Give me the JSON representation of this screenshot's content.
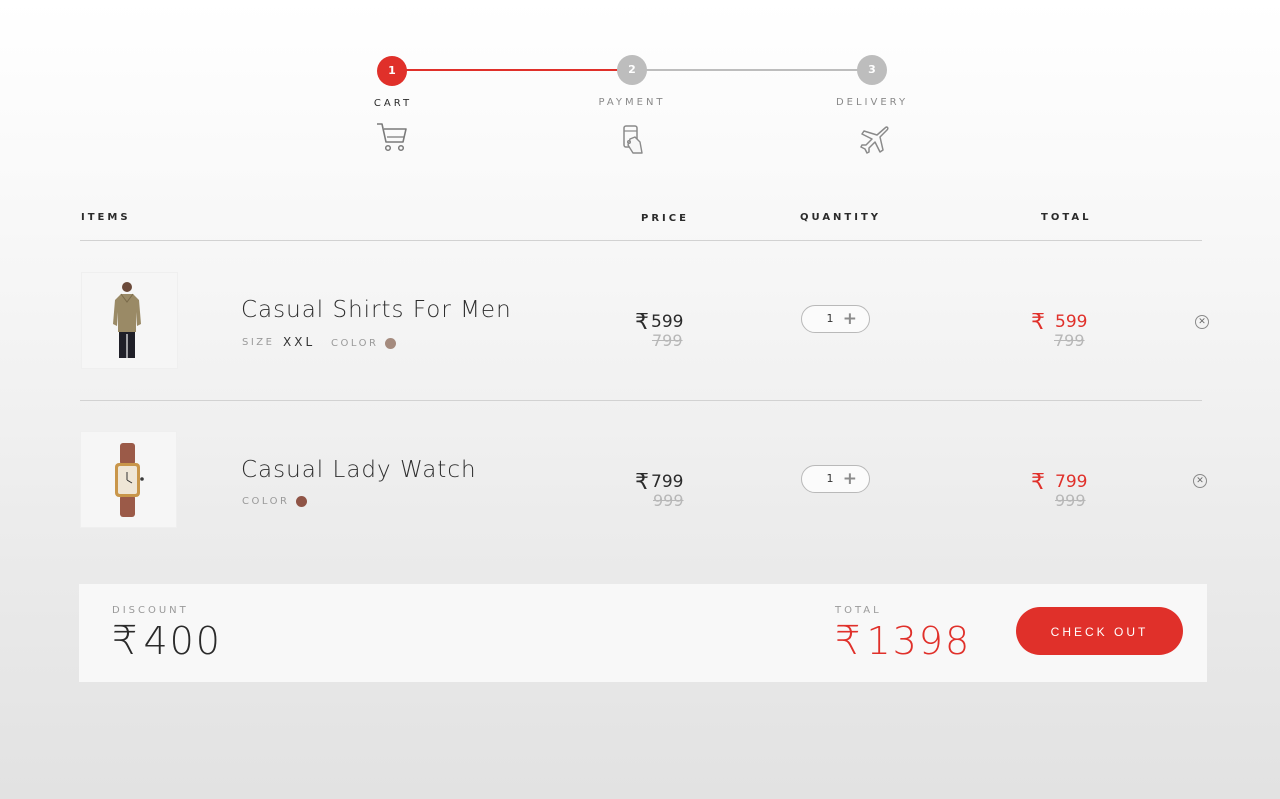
{
  "stepper": {
    "steps": [
      {
        "number": "1",
        "label": "CART",
        "icon": "cart-icon",
        "active": true
      },
      {
        "number": "2",
        "label": "PAYMENT",
        "icon": "payment-card-icon",
        "active": false
      },
      {
        "number": "3",
        "label": "DELIVERY",
        "icon": "airplane-icon",
        "active": false
      }
    ]
  },
  "table": {
    "headers": {
      "items": "ITEMS",
      "price": "PRICE",
      "quantity": "QUANTITY",
      "total": "TOTAL"
    },
    "rows": [
      {
        "name": "Casual Shirts For Men",
        "size_label": "SIZE",
        "size_value": "XXL",
        "color_label": "COLOR",
        "color_swatch": "#a58b7e",
        "currency": "₹",
        "price": "599",
        "old_price": "799",
        "quantity": "1",
        "total": "599",
        "old_total": "799"
      },
      {
        "name": "Casual Lady Watch",
        "color_label": "COLOR",
        "color_swatch": "#8f5446",
        "currency": "₹",
        "price": "799",
        "old_price": "999",
        "quantity": "1",
        "total": "799",
        "old_total": "999"
      }
    ]
  },
  "summary": {
    "discount_label": "DISCOUNT",
    "discount_amount": "400",
    "total_label": "TOTAL",
    "total_amount": "1398",
    "currency": "₹",
    "checkout_label": "CHECK OUT"
  },
  "colors": {
    "accent": "#e0302a",
    "inactive": "#b9b9b9"
  }
}
